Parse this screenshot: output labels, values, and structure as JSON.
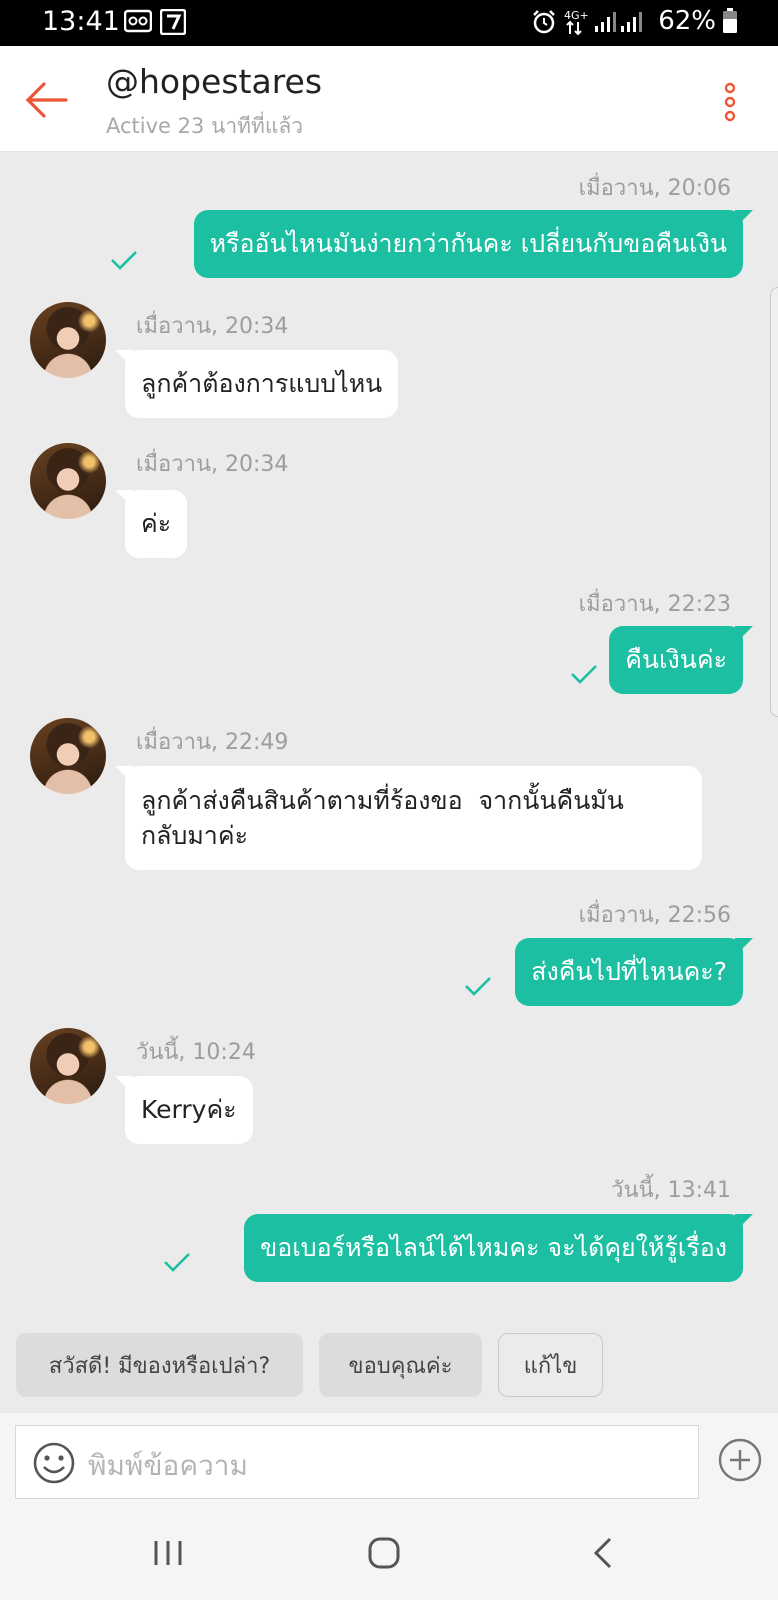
{
  "status_bar": {
    "time": "13:41",
    "battery": "62%",
    "icons": [
      "glasses-icon",
      "store-7eleven-icon",
      "alarm-icon",
      "4g-icon",
      "signal-icon",
      "battery-icon"
    ]
  },
  "header": {
    "title": "@hopestares",
    "subtitle": "Active 23 นาทีที่แล้ว",
    "back_icon": "back-arrow-icon",
    "menu_icon": "more-vertical-icon",
    "accent_color": "#ee5535"
  },
  "messages": [
    {
      "direction": "out",
      "time": "เมื่อวาน, 20:06",
      "text": "หรืออันไหนมันง่ายกว่ากันคะ เปลี่ยนกับขอคืนเงิน",
      "read": true
    },
    {
      "direction": "in",
      "time": "เมื่อวาน, 20:34",
      "text": "ลูกค้าต้องการแบบไหน"
    },
    {
      "direction": "in",
      "time": "เมื่อวาน, 20:34",
      "text": "ค่ะ"
    },
    {
      "direction": "out",
      "time": "เมื่อวาน, 22:23",
      "text": "คืนเงินค่ะ",
      "read": true
    },
    {
      "direction": "in",
      "time": "เมื่อวาน, 22:49",
      "text_lines": [
        "ลูกค้าส่งคืนสินค้าตามที่ร้องขอ  จากนั้นคืนมัน",
        "กลับมาค่ะ"
      ]
    },
    {
      "direction": "out",
      "time": "เมื่อวาน, 22:56",
      "text": "ส่งคืนไปที่ไหนคะ?",
      "read": true
    },
    {
      "direction": "in",
      "time": "วันนี้, 10:24",
      "text": "Kerryค่ะ"
    },
    {
      "direction": "out",
      "time": "วันนี้, 13:41",
      "text": "ขอเบอร์หรือไลน์ได้ไหมคะ จะได้คุยให้รู้เรื่อง",
      "read": true
    }
  ],
  "quick_replies": [
    "สวัสดี! มีของหรือเปล่า?",
    "ขอบคุณค่ะ",
    "แก้ไข"
  ],
  "input": {
    "placeholder": "พิมพ์ข้อความ",
    "emoji_icon": "smiley-icon",
    "add_icon": "plus-circle-icon"
  },
  "nav": [
    "recent-apps-icon",
    "home-icon",
    "back-icon"
  ],
  "colors": {
    "outgoing_bubble": "#1cbfa2",
    "incoming_bubble": "#ffffff",
    "chat_background": "#ebebeb",
    "read_check": "#1cbfa2"
  }
}
